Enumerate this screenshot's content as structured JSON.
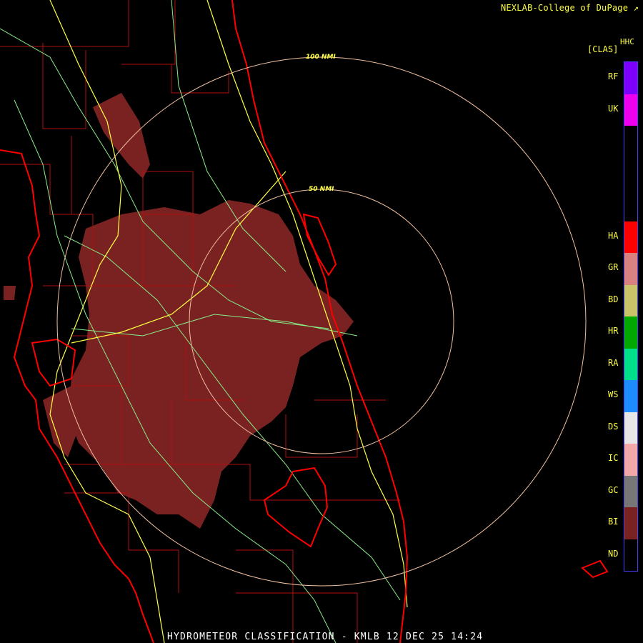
{
  "header": {
    "credit": "NEXLAB-College of DuPage ↗"
  },
  "legend": {
    "title_top": "HHC",
    "title": "[CLAS]",
    "classes": [
      {
        "label": "RF",
        "color": "#7d00ff"
      },
      {
        "label": "UK",
        "color": "#ee00ee"
      },
      {
        "label": "",
        "color": "#000000"
      },
      {
        "label": "",
        "color": "#000000"
      },
      {
        "label": "",
        "color": "#000000"
      },
      {
        "label": "HA",
        "color": "#ff0000"
      },
      {
        "label": "GR",
        "color": "#d98080"
      },
      {
        "label": "BD",
        "color": "#c9c46a"
      },
      {
        "label": "HR",
        "color": "#00a800"
      },
      {
        "label": "RA",
        "color": "#00e08a"
      },
      {
        "label": "WS",
        "color": "#1e8cff"
      },
      {
        "label": "DS",
        "color": "#e6e6e6"
      },
      {
        "label": "IC",
        "color": "#f2a8a8"
      },
      {
        "label": "GC",
        "color": "#777777"
      },
      {
        "label": "BI",
        "color": "#7a2222"
      },
      {
        "label": "ND",
        "color": "#000000"
      }
    ]
  },
  "rings": [
    {
      "label": "100 NMI"
    },
    {
      "label": "50 NMI"
    }
  ],
  "footer": {
    "caption": "HYDROMETEOR CLASSIFICATION - KMLB 12 DEC 25 14:24"
  },
  "map": {
    "echo_color": "#7a2222",
    "coast_color": "#ff0000",
    "county_color": "#b01010",
    "road_color": "#ffff44",
    "highway_color": "#88ee88",
    "ring_color": "#f0c0a0"
  }
}
